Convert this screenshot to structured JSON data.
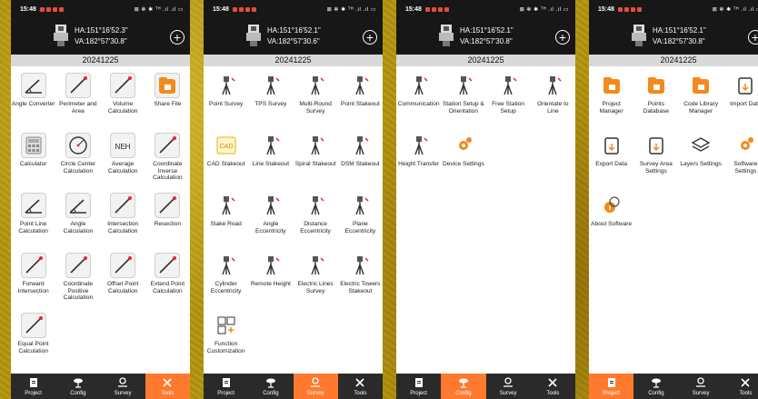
{
  "screens": [
    {
      "time": "15:48",
      "status_right": "⊠ ✻ ✱ ᵀᴴ .ıl .ıl ▭",
      "ha": "HA:151°16'52.3\"",
      "va": "VA:182°57'30.8\"",
      "date": "20241225",
      "active_tab": "tools",
      "items": [
        {
          "label": "Angle Converter",
          "icon": "angle-converter-icon"
        },
        {
          "label": "Perimeter and Area",
          "icon": "perimeter-area-icon"
        },
        {
          "label": "Volume Calculation",
          "icon": "volume-icon"
        },
        {
          "label": "Share File",
          "icon": "share-file-icon"
        },
        {
          "label": "Calculator",
          "icon": "calculator-icon"
        },
        {
          "label": "Circle Center Calculation",
          "icon": "circle-center-icon"
        },
        {
          "label": "Average Calculation",
          "icon": "average-icon"
        },
        {
          "label": "Coordinate Inverse Calculation",
          "icon": "coordinate-inverse-icon"
        },
        {
          "label": "Point Line Calculation",
          "icon": "point-line-icon"
        },
        {
          "label": "Angle Calculation",
          "icon": "angle-calc-icon"
        },
        {
          "label": "Intersection Calculation",
          "icon": "intersection-icon"
        },
        {
          "label": "Resection",
          "icon": "resection-icon"
        },
        {
          "label": "Forward Intersection",
          "icon": "forward-intersection-icon"
        },
        {
          "label": "Coordinate Positive Calculation",
          "icon": "coordinate-positive-icon"
        },
        {
          "label": "Offset Point Calculation",
          "icon": "offset-point-icon"
        },
        {
          "label": "Extend Point Calculation",
          "icon": "extend-point-icon"
        },
        {
          "label": "Equal Point Calculation",
          "icon": "equal-point-icon"
        }
      ]
    },
    {
      "time": "15:48",
      "status_right": "⊠ ✻ ✱ ᵀᴴ .ıl .ıl ▭",
      "ha": "HA:151°16'52.1\"",
      "va": "VA:182°57'30.6\"",
      "date": "20241225",
      "active_tab": "survey",
      "items": [
        {
          "label": "Point Survey",
          "icon": "point-survey-icon"
        },
        {
          "label": "TPS Survey",
          "icon": "tps-survey-icon"
        },
        {
          "label": "Multi-Round Survey",
          "icon": "multi-round-icon"
        },
        {
          "label": "Point Stakeout",
          "icon": "point-stakeout-icon"
        },
        {
          "label": "CAD Stakeout",
          "icon": "cad-stakeout-icon"
        },
        {
          "label": "Line Stakeout",
          "icon": "line-stakeout-icon"
        },
        {
          "label": "Spiral Stakeout",
          "icon": "spiral-stakeout-icon"
        },
        {
          "label": "DSM Stakeout",
          "icon": "dsm-stakeout-icon"
        },
        {
          "label": "Stake Road",
          "icon": "stake-road-icon"
        },
        {
          "label": "Angle Eccentricity",
          "icon": "angle-eccentricity-icon"
        },
        {
          "label": "Distance Eccentricity",
          "icon": "distance-eccentricity-icon"
        },
        {
          "label": "Plane Eccentricity",
          "icon": "plane-eccentricity-icon"
        },
        {
          "label": "Cylinder Eccentricity",
          "icon": "cylinder-eccentricity-icon"
        },
        {
          "label": "Remote Height",
          "icon": "remote-height-icon"
        },
        {
          "label": "Electric Lines Survey",
          "icon": "electric-lines-icon"
        },
        {
          "label": "Electric Towers Stakeout",
          "icon": "electric-towers-icon"
        },
        {
          "label": "Function Customization",
          "icon": "function-custom-icon"
        }
      ]
    },
    {
      "time": "15:48",
      "status_right": "⊠ ✻ ✱ ᵀᴴ .ıl .ıl ▭",
      "ha": "HA:151°16'52.1\"",
      "va": "VA:182°57'30.8\"",
      "date": "20241225",
      "active_tab": "config",
      "items": [
        {
          "label": "Communication",
          "icon": "communication-icon"
        },
        {
          "label": "Station Setup & Orientation",
          "icon": "station-setup-orientation-icon"
        },
        {
          "label": "Free Station Setup",
          "icon": "free-station-icon"
        },
        {
          "label": "Orientate to Line",
          "icon": "orientate-line-icon"
        },
        {
          "label": "Height Transfer",
          "icon": "height-transfer-icon"
        },
        {
          "label": "Device Settings",
          "icon": "device-settings-icon"
        }
      ]
    },
    {
      "time": "15:48",
      "status_right": "⊠ ✻ ✱ ᵀᴴ .ıl .ıl ▭",
      "ha": "HA:151°16'52.1\"",
      "va": "VA:182°57'30.8\"",
      "date": "20241225",
      "active_tab": "project",
      "items": [
        {
          "label": "Project Manager",
          "icon": "project-manager-icon"
        },
        {
          "label": "Points Database",
          "icon": "points-database-icon"
        },
        {
          "label": "Code Library Manager",
          "icon": "code-library-icon"
        },
        {
          "label": "Import Data",
          "icon": "import-data-icon"
        },
        {
          "label": "Export Data",
          "icon": "export-data-icon"
        },
        {
          "label": "Survey Area Settings",
          "icon": "survey-area-icon"
        },
        {
          "label": "Layers Settings",
          "icon": "layers-icon"
        },
        {
          "label": "Software Settings",
          "icon": "software-settings-icon"
        },
        {
          "label": "About Software",
          "icon": "about-software-icon"
        }
      ]
    }
  ],
  "nav": [
    {
      "key": "project",
      "label": "Project",
      "icon": "project-nav-icon"
    },
    {
      "key": "config",
      "label": "Config",
      "icon": "config-nav-icon"
    },
    {
      "key": "survey",
      "label": "Survey",
      "icon": "survey-nav-icon"
    },
    {
      "key": "tools",
      "label": "Tools",
      "icon": "tools-nav-icon"
    }
  ],
  "colors": {
    "active_tab": "#ff7a2e",
    "navbar": "#2a2a2a",
    "topbar": "#171717",
    "datebar": "#d9d9d9",
    "accent_icon": "#f28a1c"
  }
}
